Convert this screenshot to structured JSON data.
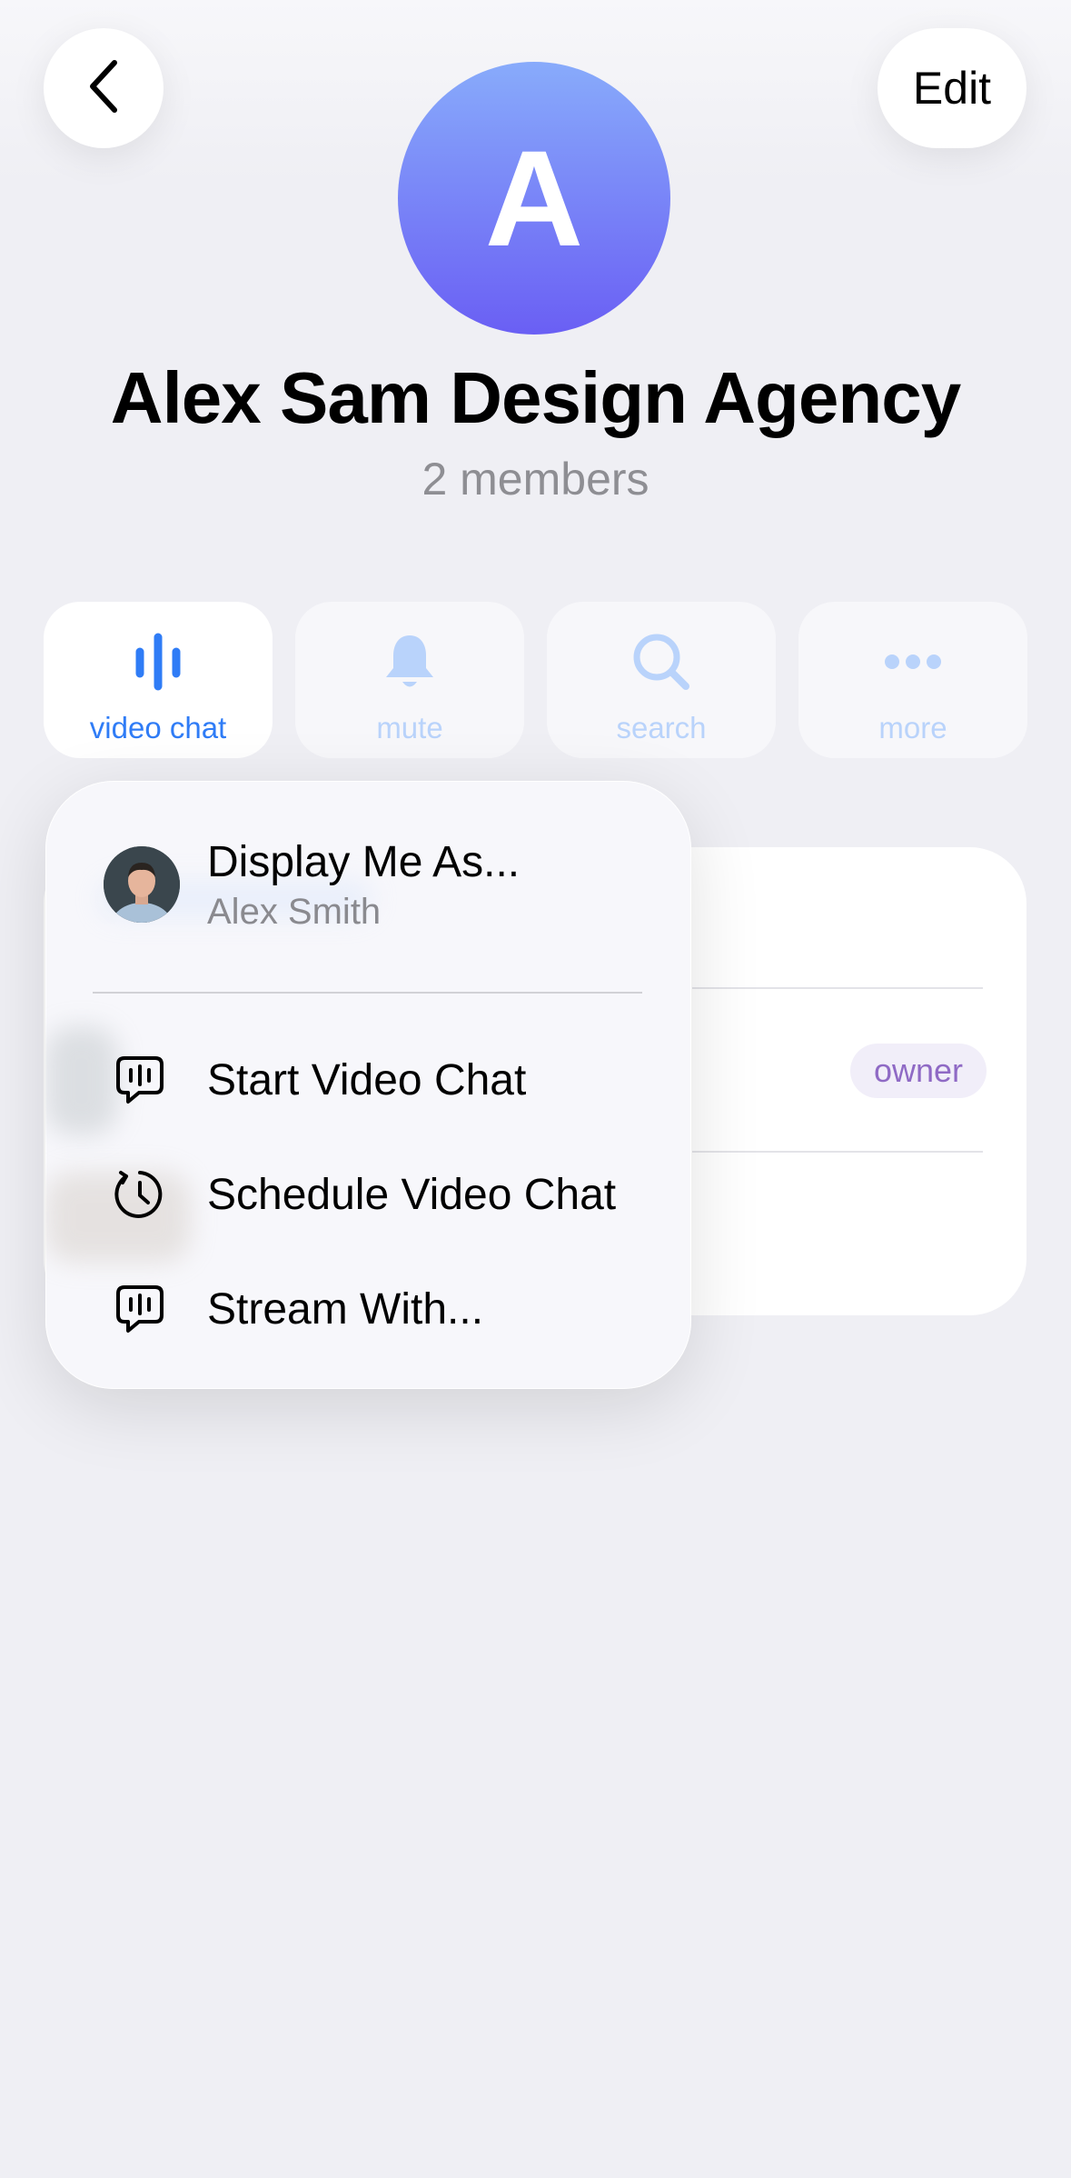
{
  "header": {
    "back_icon": "chevron-left-icon",
    "edit_label": "Edit"
  },
  "group": {
    "avatar_letter": "A",
    "avatar_colors": [
      "#88abfb",
      "#6a5ff4"
    ],
    "name": "Alex Sam Design Agency",
    "members": "2 members"
  },
  "actions": [
    {
      "label": "video chat",
      "icon": "voice-bars-icon"
    },
    {
      "label": "mute",
      "icon": "bell-icon"
    },
    {
      "label": "search",
      "icon": "search-icon"
    },
    {
      "label": "more",
      "icon": "ellipsis-icon"
    }
  ],
  "members_list": {
    "owner_badge": "owner"
  },
  "menu": {
    "display_title": "Display Me As...",
    "display_name": "Alex Smith",
    "items": [
      {
        "label": "Start Video Chat",
        "icon": "video-chat-bubble-icon"
      },
      {
        "label": "Schedule Video Chat",
        "icon": "clock-schedule-icon"
      },
      {
        "label": "Stream With...",
        "icon": "stream-bubble-icon"
      }
    ]
  },
  "colors": {
    "accent": "#2f7cf6",
    "accent_dim": "#b9d3fb",
    "background": "#efeff4",
    "owner_text": "#8f6ac5"
  }
}
